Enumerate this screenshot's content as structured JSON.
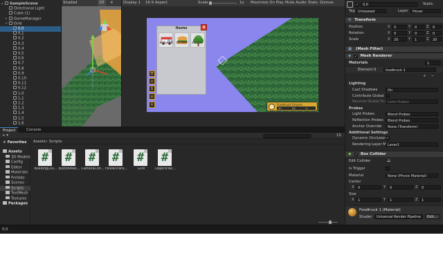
{
  "hierarchy": {
    "items": [
      {
        "label": "SampleScene",
        "level": 0,
        "fold": "▾",
        "selected": false
      },
      {
        "label": "Directional Light",
        "level": 1,
        "fold": "",
        "selected": false
      },
      {
        "label": "Cube (1)",
        "level": 1,
        "fold": "",
        "selected": false
      },
      {
        "label": "GameManager",
        "level": 1,
        "fold": "▸",
        "selected": false
      },
      {
        "label": "Grid",
        "level": 1,
        "fold": "▾",
        "selected": false
      },
      {
        "label": "0,0",
        "level": 2,
        "fold": "",
        "selected": true
      },
      {
        "label": "0,1",
        "level": 2,
        "fold": "",
        "selected": false
      },
      {
        "label": "0,2",
        "level": 2,
        "fold": "",
        "selected": false
      },
      {
        "label": "0,3",
        "level": 2,
        "fold": "",
        "selected": false
      },
      {
        "label": "0,4",
        "level": 2,
        "fold": "",
        "selected": false
      },
      {
        "label": "0,5",
        "level": 2,
        "fold": "",
        "selected": false
      },
      {
        "label": "0,6",
        "level": 2,
        "fold": "",
        "selected": false
      },
      {
        "label": "0,7",
        "level": 2,
        "fold": "",
        "selected": false
      },
      {
        "label": "0,8",
        "level": 2,
        "fold": "",
        "selected": false
      },
      {
        "label": "0,9",
        "level": 2,
        "fold": "",
        "selected": false
      },
      {
        "label": "0,10",
        "level": 2,
        "fold": "",
        "selected": false
      },
      {
        "label": "0,11",
        "level": 2,
        "fold": "",
        "selected": false
      },
      {
        "label": "0,12",
        "level": 2,
        "fold": "",
        "selected": false
      },
      {
        "label": "1,0",
        "level": 2,
        "fold": "",
        "selected": false
      },
      {
        "label": "1,1",
        "level": 2,
        "fold": "",
        "selected": false
      },
      {
        "label": "1,2",
        "level": 2,
        "fold": "",
        "selected": false
      },
      {
        "label": "1,3",
        "level": 2,
        "fold": "",
        "selected": false
      },
      {
        "label": "1,4",
        "level": 2,
        "fold": "",
        "selected": false
      },
      {
        "label": "1,5",
        "level": 2,
        "fold": "",
        "selected": false
      },
      {
        "label": "1,6",
        "level": 2,
        "fold": "",
        "selected": false
      }
    ]
  },
  "scene_view": {
    "shading_mode": "Shaded",
    "mode_2d": "2D"
  },
  "game_view": {
    "display": "Display 1",
    "aspect": "16:9 Aspect",
    "scale_label": "Scale",
    "scale_value": "1x",
    "toggles": [
      "Maximize On Play",
      "Mute Audio",
      "Stats",
      "Gizmos"
    ],
    "items_panel": {
      "title": "Items",
      "close_glyph": "x",
      "items": [
        {
          "name": "foodtruck",
          "price": "$45,000"
        },
        {
          "name": "burger",
          "price": "$7,500"
        },
        {
          "name": "tree",
          "price": "$5,000"
        }
      ]
    },
    "tool_buttons": [
      "hammer-icon",
      "factory-icon",
      "money-icon",
      "menu-icon",
      "close-icon"
    ],
    "foodtruck_ui": {
      "name": "Foodtruck Empire",
      "stats": [
        "$0",
        "$0",
        "0"
      ]
    }
  },
  "project": {
    "tabs": [
      "Project",
      "Console"
    ],
    "add_label": "+ ▾",
    "search_placeholder": "",
    "count": "15",
    "tree": [
      {
        "label": "Favorites",
        "bold": true,
        "icon": "star-icon",
        "selected": false
      },
      {
        "label": "Assets",
        "bold": true,
        "icon": "folder-icon",
        "selected": false
      },
      {
        "label": "3D Models",
        "bold": false,
        "icon": "folder-icon",
        "selected": false
      },
      {
        "label": "Config",
        "bold": false,
        "icon": "folder-icon",
        "selected": false
      },
      {
        "label": "Editor",
        "bold": false,
        "icon": "folder-icon",
        "selected": false
      },
      {
        "label": "Materials",
        "bold": false,
        "icon": "folder-icon",
        "selected": false
      },
      {
        "label": "Prefabs",
        "bold": false,
        "icon": "folder-icon",
        "selected": false
      },
      {
        "label": "Scenes",
        "bold": false,
        "icon": "folder-icon",
        "selected": false
      },
      {
        "label": "Scripts",
        "bold": false,
        "icon": "folder-icon",
        "selected": true
      },
      {
        "label": "TextMesh",
        "bold": false,
        "icon": "folder-icon",
        "selected": false
      },
      {
        "label": "Textures",
        "bold": false,
        "icon": "folder-icon",
        "selected": false
      },
      {
        "label": "Packages",
        "bold": true,
        "icon": "folder-icon",
        "selected": false
      }
    ],
    "breadcrumb": [
      "Assets",
      "Scripts"
    ],
    "breadcrumb_sep": ">",
    "assets": [
      {
        "label": "BuildingColl..."
      },
      {
        "label": "ButtonMan..."
      },
      {
        "label": "CameraCon..."
      },
      {
        "label": "FollowTrans..."
      },
      {
        "label": "Grid"
      },
      {
        "label": "ObjectPlac..."
      }
    ]
  },
  "status_bar": {
    "text": "0,0"
  },
  "inspector": {
    "object_name": "0,0",
    "static_label": "Static",
    "tag_label": "Tag",
    "tag_value": "Untagged",
    "layer_label": "Layer",
    "layer_value": "Hover",
    "transform": {
      "title": "Transform",
      "position": {
        "label": "Position",
        "x": "0",
        "y": "0",
        "z": "0"
      },
      "rotation": {
        "label": "Rotation",
        "x": "0",
        "y": "0",
        "z": "0"
      },
      "scale": {
        "label": "Scale",
        "x": "20",
        "y": "1",
        "z": "20"
      }
    },
    "mesh_filter_title": "(Mesh Filter)",
    "mesh_renderer": {
      "title": "Mesh Renderer",
      "materials_label": "Materials",
      "materials_count": "1",
      "element_label": "Element 0",
      "element_value": "foodtruck 1",
      "lighting_label": "Lighting",
      "cast_shadows_label": "Cast Shadows",
      "cast_shadows_value": "On",
      "contribute_gi_label": "Contribute Global",
      "receive_gi_label": "Receive Global Illum",
      "receive_gi_value": "Light Probes",
      "probes_label": "Probes",
      "light_probes_label": "Light Probes",
      "light_probes_value": "Blend Probes",
      "reflection_probes_label": "Reflection Probes",
      "reflection_probes_value": "Blend Probes",
      "anchor_override_label": "Anchor Override",
      "anchor_override_value": "None (Transform)",
      "additional_label": "Additional Settings",
      "dynamic_occlusion_label": "Dynamic Occlusion",
      "dynamic_occlusion_check": "✓",
      "rendering_layer_label": "Rendering Layer M",
      "rendering_layer_value": "Layer1"
    },
    "box_collider": {
      "title": "Box Collider",
      "edit_collider_label": "Edit Collider",
      "is_trigger_label": "Is Trigger",
      "material_label": "Material",
      "material_value": "None (Physic Material)",
      "center_label": "Center",
      "center": {
        "x": "0",
        "y": "0",
        "z": "0"
      },
      "size_label": "Size",
      "size": {
        "x": "1",
        "y": "1",
        "z": "1"
      }
    },
    "material": {
      "title": "Foodtruck 1 (Material)",
      "shader_label": "Shader",
      "shader_value": "Universal Render Pipeline",
      "edit_label": "Edit..."
    }
  },
  "colors": {
    "selection": "#2c5d87",
    "game_background": "#8a86ee",
    "grass": "#2f6a3a",
    "gizmo_orange": "#e8a33a",
    "accent_blue": "#4a8cd4"
  }
}
